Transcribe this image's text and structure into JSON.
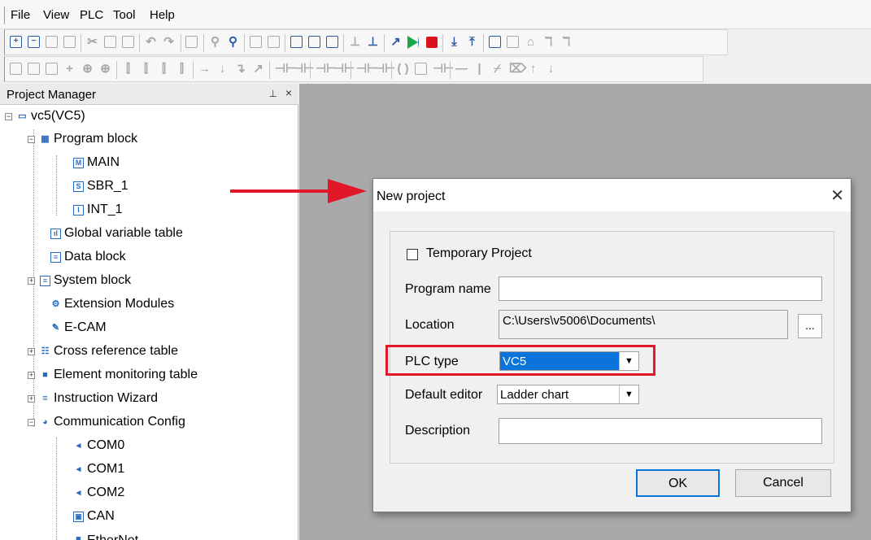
{
  "menubar": {
    "items": [
      "File",
      "View",
      "PLC",
      "Tool",
      "Help"
    ]
  },
  "project_manager": {
    "title": "Project Manager",
    "tree": {
      "root": "vc5(VC5)",
      "program_block": "Program block",
      "main": "MAIN",
      "sbr": "SBR_1",
      "int": "INT_1",
      "global_var": "Global variable table",
      "data_block": "Data block",
      "system_block": "System block",
      "ext_modules": "Extension Modules",
      "ecam": "E-CAM",
      "cross_ref": "Cross reference table",
      "elem_monitor": "Element monitoring table",
      "instr_wizard": "Instruction Wizard",
      "comm_config": "Communication Config",
      "com0": "COM0",
      "com1": "COM1",
      "com2": "COM2",
      "can": "CAN",
      "ethernet": "EtherNet"
    }
  },
  "dialog": {
    "title": "New project",
    "temporary_project": "Temporary Project",
    "program_name_label": "Program name",
    "program_name_value": "",
    "location_label": "Location",
    "location_value": "C:\\Users\\v5006\\Documents\\",
    "browse_label": "...",
    "plc_type_label": "PLC type",
    "plc_type_value": "VC5",
    "default_editor_label": "Default editor",
    "default_editor_value": "Ladder chart",
    "description_label": "Description",
    "description_value": "",
    "ok_label": "OK",
    "cancel_label": "Cancel"
  },
  "colors": {
    "highlight": "#e0182a",
    "selection": "#0a74da",
    "editor_bg": "#a9a9a9"
  }
}
